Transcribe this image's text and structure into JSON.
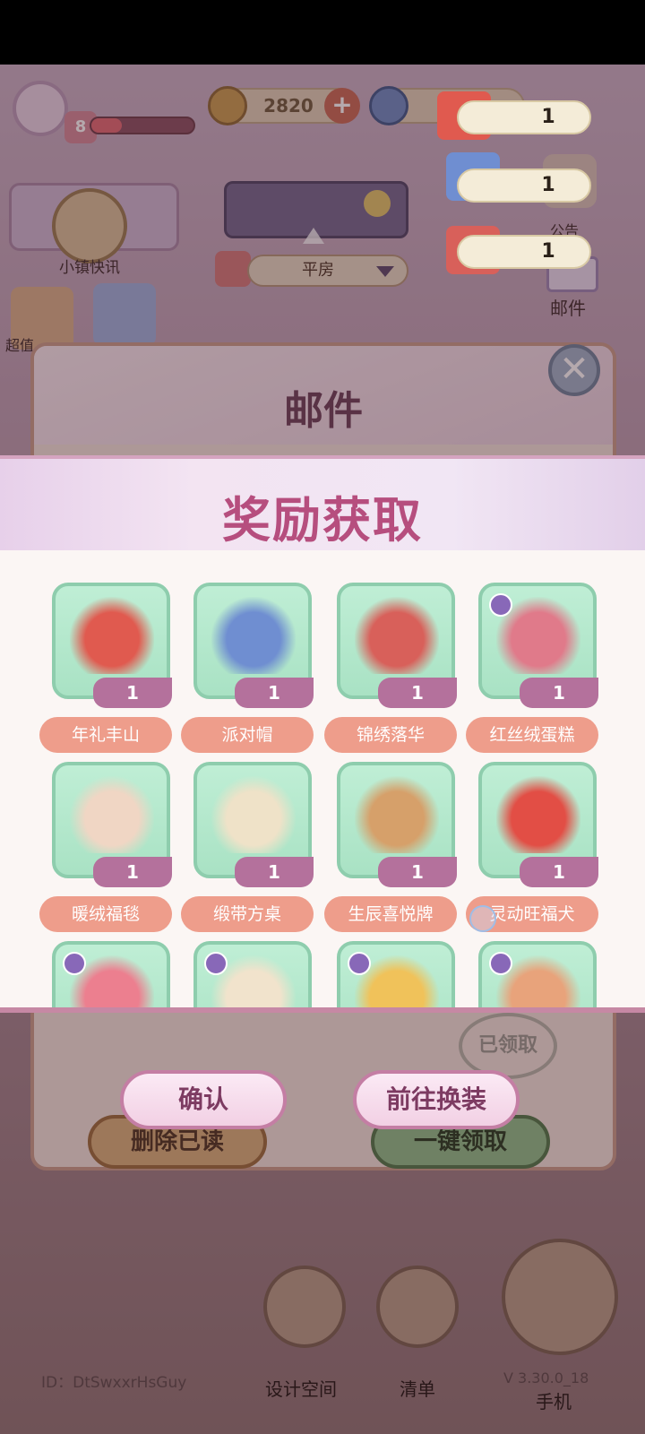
{
  "hud": {
    "level": "8",
    "coins": "2820",
    "town_news_label": "小镇快讯",
    "house_label": "平房",
    "deal_label": "超值",
    "mail_side_label": "邮件",
    "side_top_label": "公告"
  },
  "reward_chips": [
    {
      "count": "1"
    },
    {
      "count": "1"
    },
    {
      "count": "1"
    }
  ],
  "mail": {
    "title": "邮件",
    "close_symbol": "✕",
    "claimed_stamp": "已领取",
    "delete_read_label": "删除已读",
    "collect_all_label": "一键领取"
  },
  "reward": {
    "title": "奖励获取",
    "items": [
      {
        "name": "年礼丰山",
        "count": "1",
        "art_color": "#e05a4f",
        "badge": false
      },
      {
        "name": "派对帽",
        "count": "1",
        "art_color": "#6f8ed1",
        "badge": false
      },
      {
        "name": "锦绣落华",
        "count": "1",
        "art_color": "#d8605a",
        "badge": false
      },
      {
        "name": "红丝绒蛋糕",
        "count": "1",
        "art_color": "#e07a8a",
        "badge": true
      },
      {
        "name": "暖绒福毯",
        "count": "1",
        "art_color": "#f0d6c4",
        "badge": false
      },
      {
        "name": "缎带方桌",
        "count": "1",
        "art_color": "#efe2c8",
        "badge": false
      },
      {
        "name": "生辰喜悦牌",
        "count": "1",
        "art_color": "#d6a06a",
        "badge": false
      },
      {
        "name": "灵动旺福犬",
        "count": "1",
        "art_color": "#e24e45",
        "badge": false
      },
      {
        "name": "",
        "count": "",
        "art_color": "#ec7f8f",
        "badge": true
      },
      {
        "name": "",
        "count": "",
        "art_color": "#f1e3cc",
        "badge": true
      },
      {
        "name": "",
        "count": "",
        "art_color": "#f0c25a",
        "badge": true
      },
      {
        "name": "",
        "count": "",
        "art_color": "#e8a37b",
        "badge": true
      }
    ],
    "confirm_label": "确认",
    "dress_up_label": "前往换装"
  },
  "bottom": {
    "design_space_label": "设计空间",
    "list_label": "清单",
    "phone_label": "手机",
    "uid": "ID：DtSwxxrHsGuy",
    "version": "V 3.30.0_18"
  },
  "colors": {
    "reward_title": "#b64e7e",
    "item_name_bg": "#ee9d8b",
    "item_count_bg": "#b4719c",
    "card_bg": "#bfeed5"
  }
}
